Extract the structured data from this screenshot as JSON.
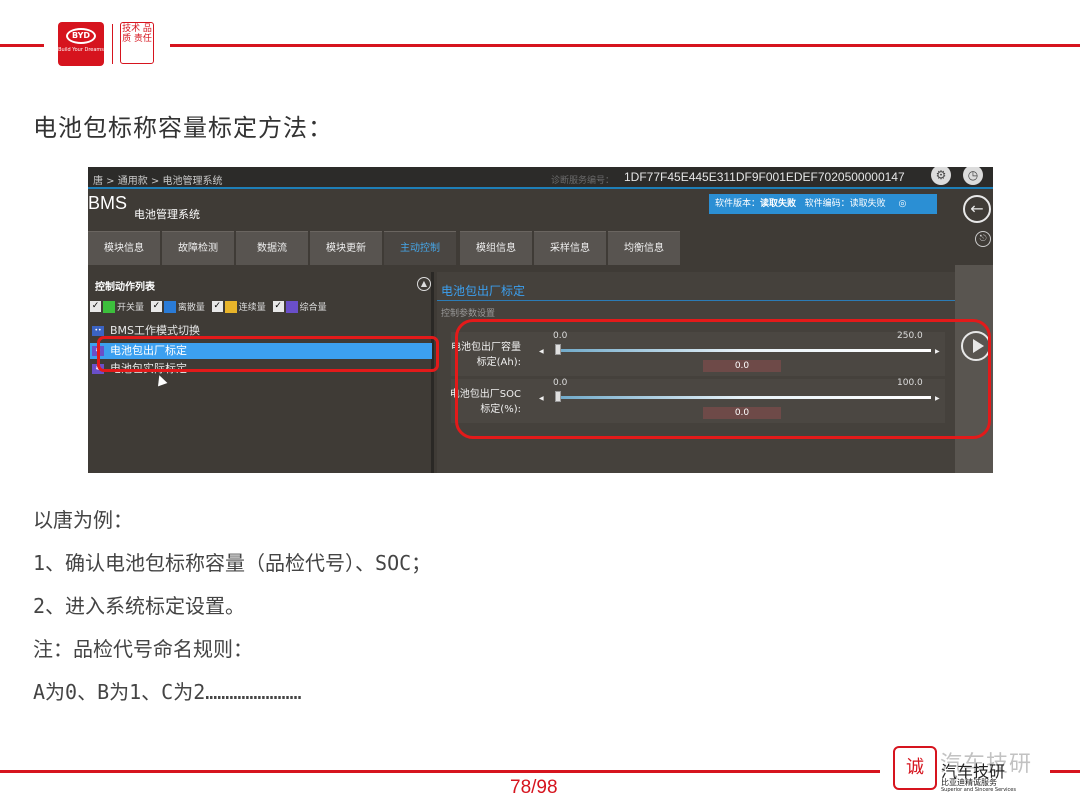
{
  "header": {
    "logo_text": "BYD",
    "logo_tagline": "Build Your Dreams",
    "seal_text": "技术 品质 责任"
  },
  "slide_title": "电池包标称容量标定方法：",
  "app": {
    "breadcrumb": "唐 > 通用款 > 电池管理系统",
    "diag_label": "诊断服务编号：",
    "diag_value": "1DF77F45E445E311DF9F001EDEF7020500000147",
    "title": "BMS",
    "subtitle": "电池管理系统",
    "version": {
      "sw_version_label": "软件版本：",
      "sw_version_value": "读取失败",
      "sw_code_label": "软件编码：",
      "sw_code_value": "读取失败"
    },
    "tabs": [
      {
        "label": "模块信息",
        "active": false
      },
      {
        "label": "故障检测",
        "active": false
      },
      {
        "label": "数据流",
        "active": false
      },
      {
        "label": "模块更新",
        "active": false
      },
      {
        "label": "主动控制",
        "active": true
      },
      {
        "label": "模组信息",
        "active": false
      },
      {
        "label": "采样信息",
        "active": false
      },
      {
        "label": "均衡信息",
        "active": false
      }
    ],
    "left_panel": {
      "header": "控制动作列表",
      "filters": [
        {
          "label": "开关量",
          "color": "#3cbf3c",
          "symbol": "O"
        },
        {
          "label": "离散量",
          "color": "#2a7bd6",
          "symbol": "→"
        },
        {
          "label": "连续量",
          "color": "#e8b42a",
          "symbol": "~"
        },
        {
          "label": "综合量",
          "color": "#6a4fc9",
          "symbol": "*"
        }
      ],
      "items": [
        {
          "label": "BMS工作模式切换",
          "selected": false
        },
        {
          "label": "电池包出厂标定",
          "selected": true
        },
        {
          "label": "电池包实际标定",
          "selected": false
        }
      ]
    },
    "right_panel": {
      "title": "电池包出厂标定",
      "param_label": "控制参数设置",
      "params": [
        {
          "name_line1": "电池包出厂容量",
          "name_line2": "标定(Ah):",
          "min": "0.0",
          "max": "250.0",
          "value": "0.0"
        },
        {
          "name_line1": "电池包出厂SOC",
          "name_line2": "标定(%):",
          "min": "0.0",
          "max": "100.0",
          "value": "0.0"
        }
      ]
    }
  },
  "body": [
    "以唐为例：",
    "1、确认电池包标称容量（品检代号）、SOC；",
    "2、进入系统标定设置。",
    "注：品检代号命名规则：",
    "A为0、B为1、C为2……………………"
  ],
  "footer": {
    "page": "78/98",
    "seal_text": "诚",
    "brand": "汽车技研",
    "sub1": "比亚迪精诚服务",
    "sub2": "Superior and Sincere Services",
    "watermark": "汽车技研"
  },
  "colors": {
    "brand_red": "#d6141e",
    "accent_blue": "#3ca0f0"
  }
}
